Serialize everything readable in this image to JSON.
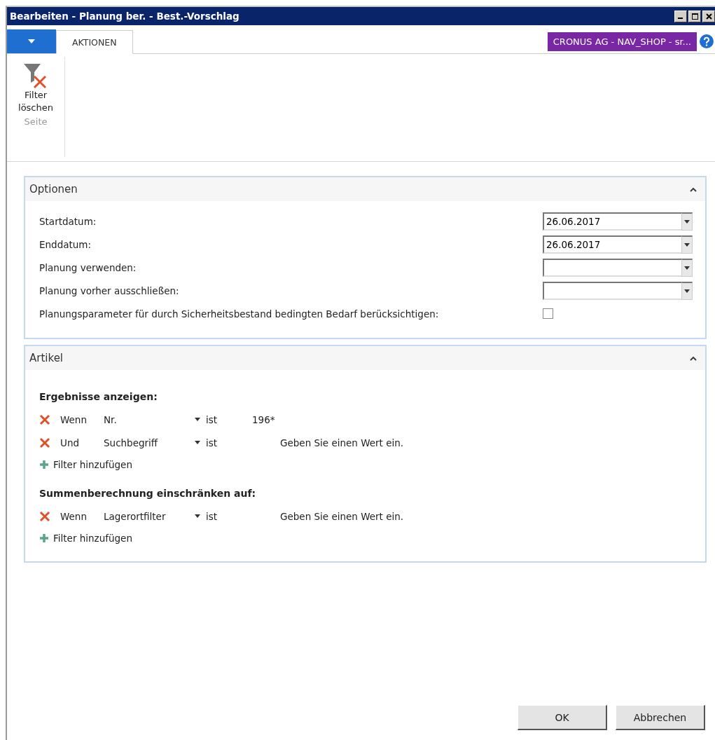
{
  "window": {
    "title": "Bearbeiten - Planung ber. - Best.-Vorschlag"
  },
  "ribbon": {
    "tabs": [
      {
        "label": "AKTIONEN",
        "selected": true
      }
    ],
    "company": "CRONUS AG - NAV_SHOP - sr...",
    "actions": [
      {
        "label": "Filter löschen"
      }
    ],
    "group": "Seite"
  },
  "options": {
    "title": "Optionen",
    "expanded": true,
    "fields": [
      {
        "kind": "date",
        "label": "Startdatum:",
        "value": "26.06.2017"
      },
      {
        "kind": "date",
        "label": "Enddatum:",
        "value": "26.06.2017"
      },
      {
        "kind": "select",
        "label": "Planung verwenden:"
      },
      {
        "kind": "select",
        "label": "Planung vorher ausschließen:"
      },
      {
        "kind": "checkbox",
        "label": "Planungsparameter für durch Sicherheitsbestand bedingten Bedarf berücksichtigen:",
        "checked": false
      }
    ]
  },
  "articles": {
    "title": "Artikel",
    "expanded": true,
    "groups": [
      {
        "heading": "Ergebnisse anzeigen:",
        "filters": [
          {
            "conjunction": "Wenn",
            "field": "Nr.",
            "operator": "ist",
            "value": "196*"
          },
          {
            "conjunction": "Und",
            "field": "Suchbegriff",
            "operator": "ist",
            "placeholder": "Geben Sie einen Wert ein."
          }
        ],
        "add_label": "Filter hinzufügen"
      },
      {
        "heading": "Summenberechnung einschränken auf:",
        "filters": [
          {
            "conjunction": "Wenn",
            "field": "Lagerortfilter",
            "operator": "ist",
            "placeholder": "Geben Sie einen Wert ein."
          }
        ],
        "add_label": "Filter hinzufügen"
      }
    ]
  },
  "buttons": [
    "OK",
    "Abbrechen"
  ]
}
